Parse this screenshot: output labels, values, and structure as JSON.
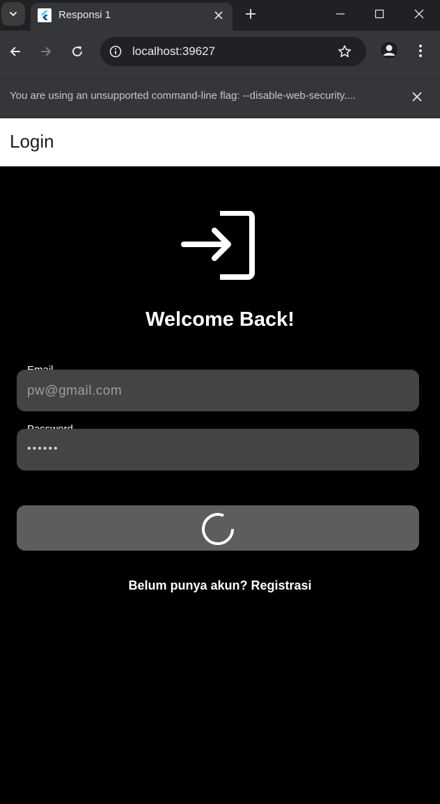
{
  "browser": {
    "tab_title": "Responsi 1",
    "url": "localhost:39627",
    "infobar_message": "You are using an unsupported command-line flag: --disable-web-security...."
  },
  "app": {
    "appbar_title": "Login",
    "welcome_text": "Welcome Back!",
    "email": {
      "label": "Email",
      "value": "pw@gmail.com"
    },
    "password": {
      "label": "Password",
      "value": "••••••"
    },
    "register_text": "Belum punya akun? Registrasi"
  },
  "colors": {
    "browser_frame": "#202124",
    "toolbar": "#35363a",
    "app_background": "#000000",
    "field_background": "#444444",
    "button_background": "#5d5d5d"
  },
  "icons": [
    "tab-search-icon",
    "flutter-favicon-icon",
    "close-icon",
    "plus-icon",
    "minimize-icon",
    "maximize-icon",
    "back-icon",
    "forward-icon",
    "reload-icon",
    "info-icon",
    "star-icon",
    "profile-icon",
    "more-vert-icon",
    "login-icon",
    "loading-spinner-icon"
  ]
}
